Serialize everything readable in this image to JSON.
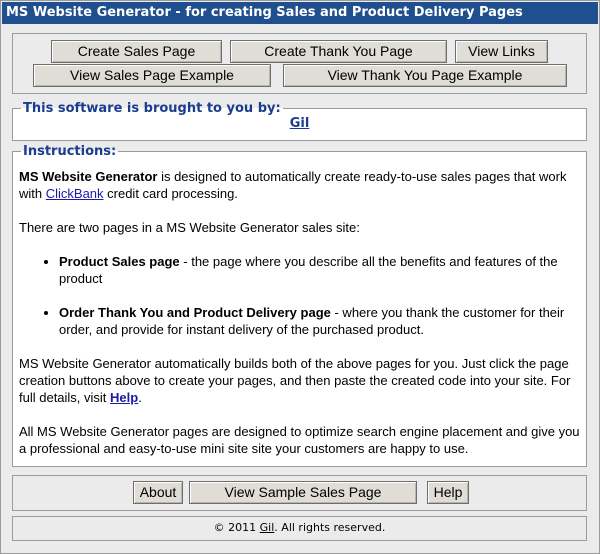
{
  "window": {
    "title": "MS Website Generator - for creating Sales and Product Delivery Pages"
  },
  "toolbar": {
    "create_sales_page": "Create Sales Page",
    "create_thank_you_page": "Create Thank You Page",
    "view_links": "View Links",
    "view_sales_page_example": "View Sales Page Example",
    "view_thank_you_page_example": "View Thank You Page Example"
  },
  "brought_by": {
    "legend": "This software is brought to you by:",
    "author": "Gil"
  },
  "instructions": {
    "legend": "Instructions:",
    "p1_bold": "MS Website Generator",
    "p1_text_a": " is designed to automatically create ready-to-use sales pages that work with ",
    "p1_link": "ClickBank",
    "p1_text_b": " credit card processing.",
    "p2": "There are two pages in a MS Website Generator sales site:",
    "bullets": [
      {
        "bold": "Product Sales page",
        "text": " - the page where you describe all the benefits and features of the product"
      },
      {
        "bold": "Order Thank You and Product Delivery page",
        "text": " - where you thank the customer for their order, and provide for instant delivery of the purchased product."
      }
    ],
    "p3_text": "MS Website Generator automatically builds both of the above pages for you. Just click the page creation buttons above to create your pages, and then paste the created code into your site. For full details, visit ",
    "p3_link": "Help",
    "p3_end": ".",
    "p4": "All MS Website Generator pages are designed to optimize search engine placement and give you a professional and easy-to-use mini site site your customers are happy to use."
  },
  "bottom_bar": {
    "about": "About",
    "view_sample_sales_page": "View Sample Sales Page",
    "help": "Help"
  },
  "footer": {
    "prefix": "© 2011 ",
    "author_link": "Gil",
    "suffix": ". All rights reserved."
  }
}
